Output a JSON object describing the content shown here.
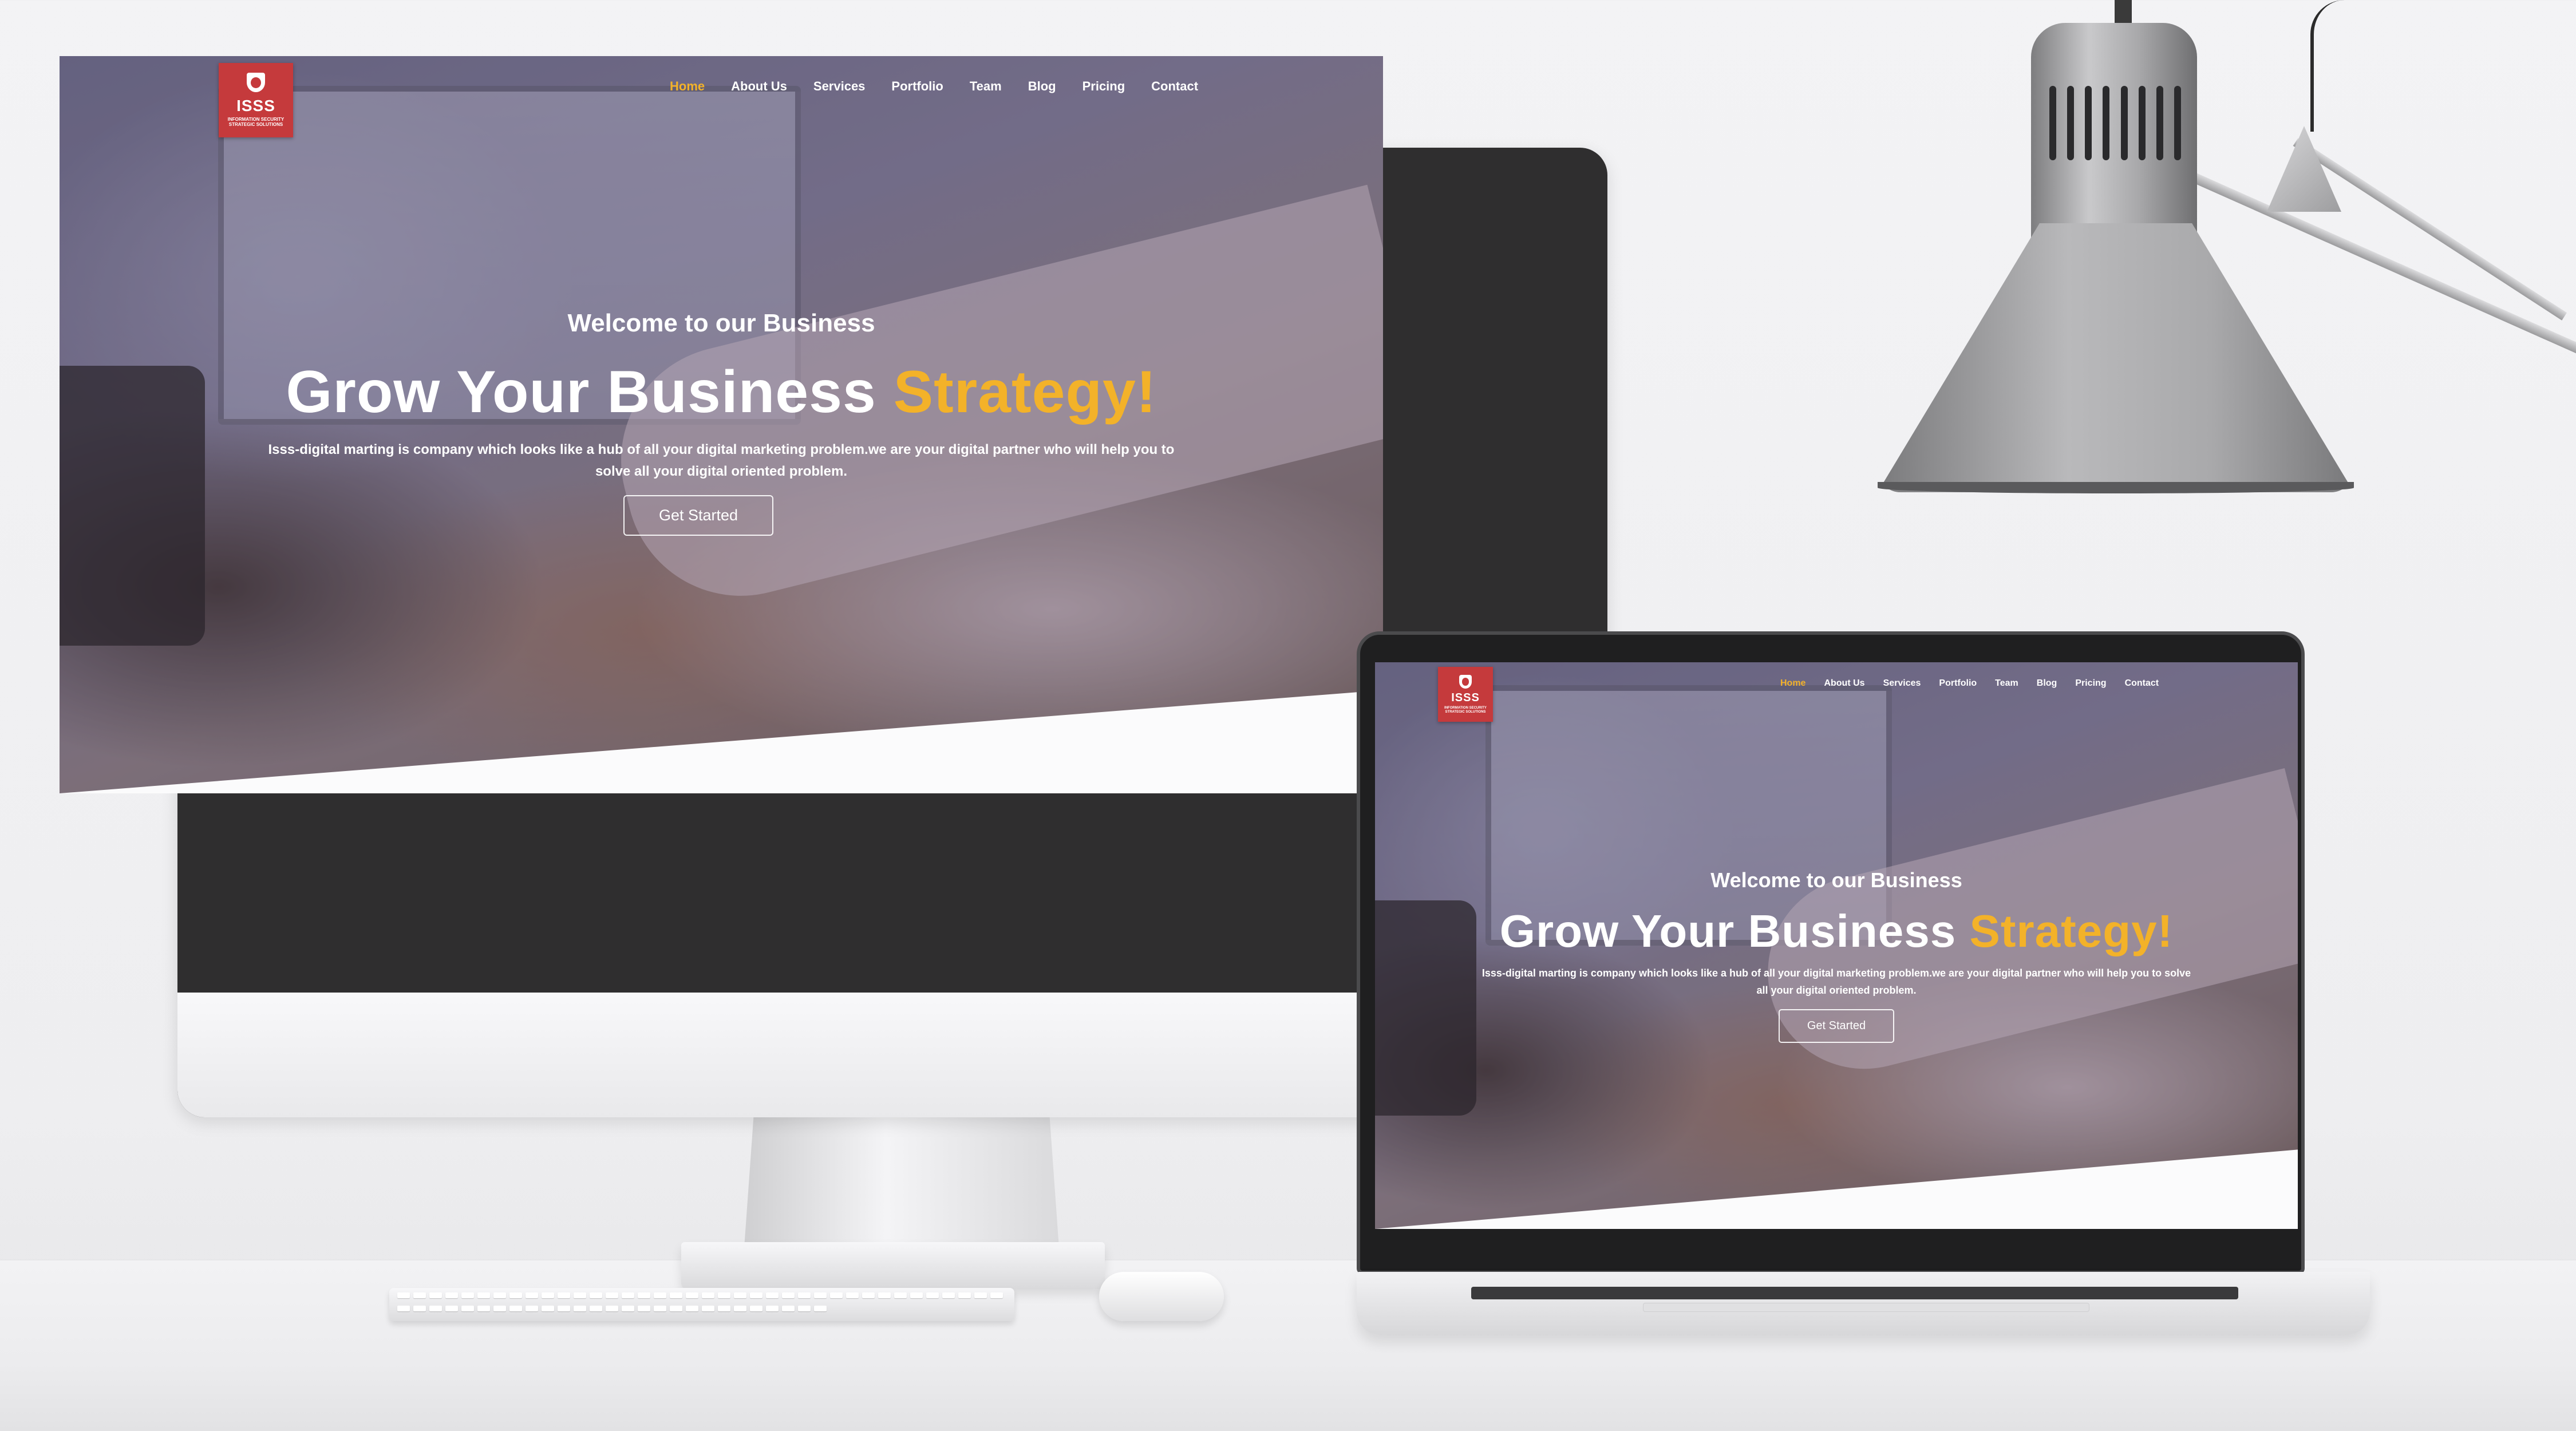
{
  "site": {
    "logo": {
      "name": "ISSS",
      "tagline": "INFORMATION SECURITY STRATEGIC SOLUTIONS",
      "color": "#c53a3c"
    },
    "nav": [
      {
        "label": "Home",
        "active": true
      },
      {
        "label": "About Us",
        "active": false
      },
      {
        "label": "Services",
        "active": false
      },
      {
        "label": "Portfolio",
        "active": false
      },
      {
        "label": "Team",
        "active": false
      },
      {
        "label": "Blog",
        "active": false
      },
      {
        "label": "Pricing",
        "active": false
      },
      {
        "label": "Contact",
        "active": false
      }
    ],
    "hero": {
      "welcome": "Welcome to our Business",
      "headline": "Grow Your Business",
      "highlight": "Strategy!",
      "description": "Isss-digital marting is company which looks like a hub of all your digital marketing problem.we are your digital partner who will help you to solve all your digital oriented problem.",
      "cta_label": "Get Started"
    },
    "colors": {
      "accent": "#f3b229",
      "nav_text": "#ffffff"
    }
  },
  "icons": {
    "logo_icon": "shield-icon"
  }
}
